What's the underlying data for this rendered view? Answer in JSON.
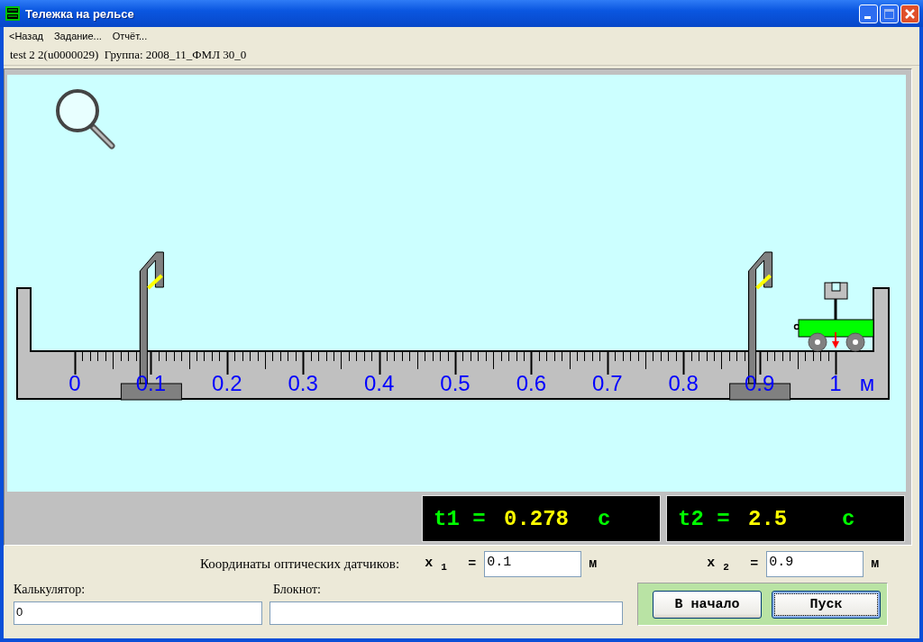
{
  "window": {
    "title": "Тележка на рельсе"
  },
  "menu": [
    {
      "label": "<Назад"
    },
    {
      "label": "Задание..."
    },
    {
      "label": "Отчёт..."
    }
  ],
  "info_line": "test 2 2(u0000029)  Группа: 2008_11_ФМЛ 30_0",
  "scale": {
    "labels": [
      "0",
      "0.1",
      "0.2",
      "0.3",
      "0.4",
      "0.5",
      "0.6",
      "0.7",
      "0.8",
      "0.9",
      "1"
    ],
    "unit": "м"
  },
  "timers": [
    {
      "label": "t1 =",
      "value": "0.278",
      "unit": "с"
    },
    {
      "label": "t2 =",
      "value": "2.5",
      "unit": "с"
    }
  ],
  "sensors": {
    "caption": "Координаты оптических датчиков:",
    "fields": [
      {
        "label": "x $_{1}$",
        "equals": "=",
        "value": "0.1",
        "unit": "м"
      },
      {
        "label": "x $_{2}$",
        "equals": "=",
        "value": "0.9",
        "unit": "м"
      }
    ]
  },
  "calculator": {
    "label": "Калькулятор:",
    "value": "0"
  },
  "notepad": {
    "label": "Блокнот:"
  },
  "buttons": [
    {
      "label": "В начало",
      "focused": false
    },
    {
      "label": "Пуск",
      "focused": true
    }
  ]
}
